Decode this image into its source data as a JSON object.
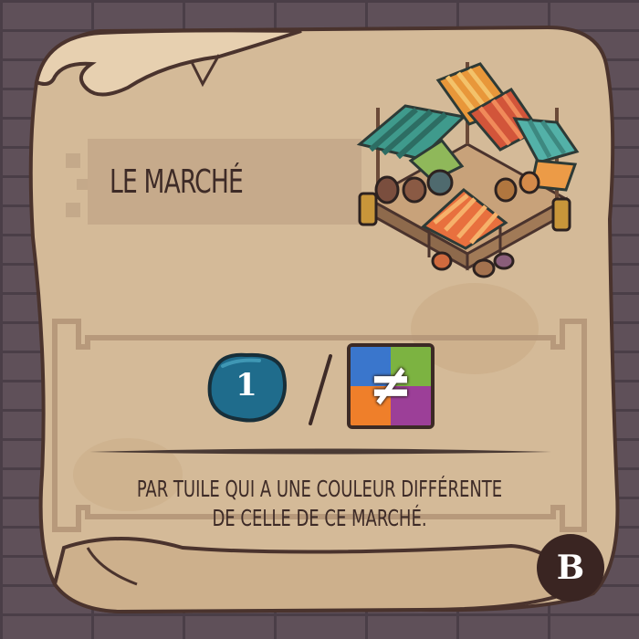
{
  "card": {
    "title": "LE MARCHÉ",
    "illustration": "market-stalls-illustration",
    "scoring": {
      "points_value": "1",
      "points_icon": "blue-stone-token",
      "separator": "/",
      "condition_icon": "not-equal-color-tile",
      "condition_symbol": "≠",
      "quadrant_colors": [
        "#3a76cc",
        "#7cb341",
        "#ef7f2a",
        "#9c3f98"
      ]
    },
    "description_line1": "PAR TUILE QUI A UNE COULEUR DIFFÉRENTE",
    "description_line2": "DE CELLE DE CE MARCHÉ.",
    "side_badge": "B"
  },
  "colors": {
    "parchment": "#d3b896",
    "ink": "#3e2b27",
    "badge": "#3a2522",
    "coin": "#1d5d7a"
  }
}
